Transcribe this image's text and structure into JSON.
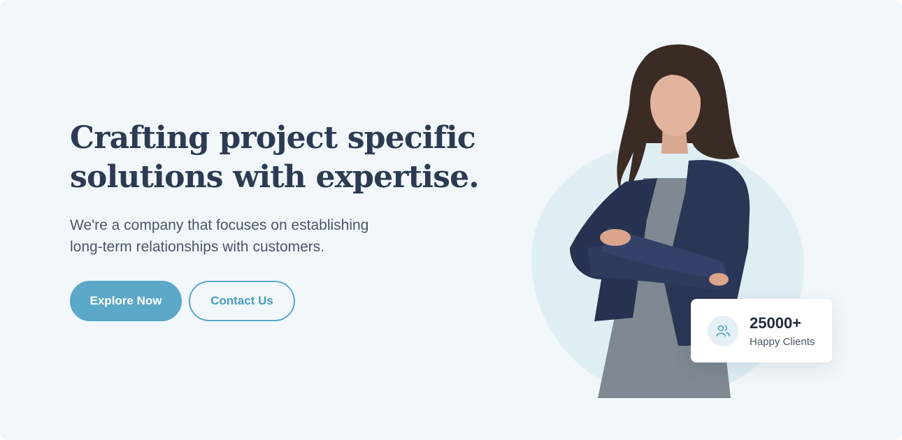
{
  "hero": {
    "heading_lines": [
      "Crafting project specific",
      "solutions with expertise."
    ],
    "subtitle_lines": [
      "We're a company that focuses on establishing",
      "long-term relationships with customers."
    ],
    "primary_button": "Explore Now",
    "secondary_button": "Contact Us"
  },
  "stat_card": {
    "value": "25000+",
    "label": "Happy Clients",
    "icon": "users-icon"
  },
  "colors": {
    "background": "#f2f7fb",
    "heading": "#2c3a52",
    "accent": "#5ba8c9",
    "blob": "#dfeef3"
  }
}
